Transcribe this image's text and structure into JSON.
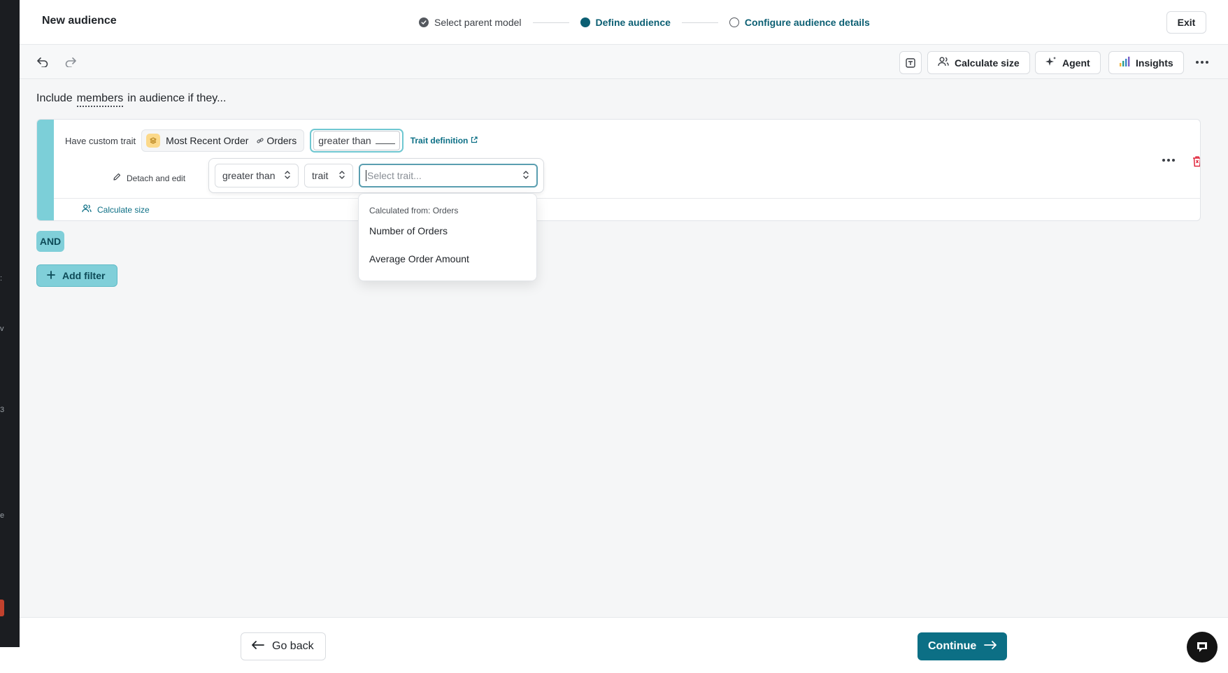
{
  "header": {
    "title": "New audience",
    "steps": [
      {
        "label": "Select parent model",
        "state": "done"
      },
      {
        "label": "Define audience",
        "state": "active"
      },
      {
        "label": "Configure audience details",
        "state": "next"
      }
    ],
    "exit_label": "Exit"
  },
  "toolbar": {
    "undo_icon": "undo-icon",
    "redo_icon": "redo-icon",
    "calculate_size_label": "Calculate size",
    "agent_label": "Agent",
    "insights_label": "Insights"
  },
  "builder": {
    "include_prefix": "Include",
    "include_entity": "members",
    "include_suffix": "in audience if they...",
    "filter": {
      "prefix": "Have custom trait",
      "trait_name": "Most Recent Order",
      "trait_model": "Orders",
      "operator_summary": "greater than",
      "trait_definition_label": "Trait definition",
      "detach_label": "Detach and edit",
      "calculate_size_label": "Calculate size"
    },
    "editor": {
      "operator_value": "greater than",
      "value_type": "trait",
      "trait_placeholder": "Select trait..."
    },
    "dropdown": {
      "group_label": "Calculated from: Orders",
      "options": [
        "Number of Orders",
        "Average Order Amount"
      ]
    },
    "and_label": "AND",
    "add_filter_label": "Add filter"
  },
  "footer": {
    "go_back_label": "Go back",
    "continue_label": "Continue"
  },
  "colors": {
    "accent": "#0c6f85",
    "teal_light": "#80cfd9",
    "danger": "#e0243a"
  }
}
